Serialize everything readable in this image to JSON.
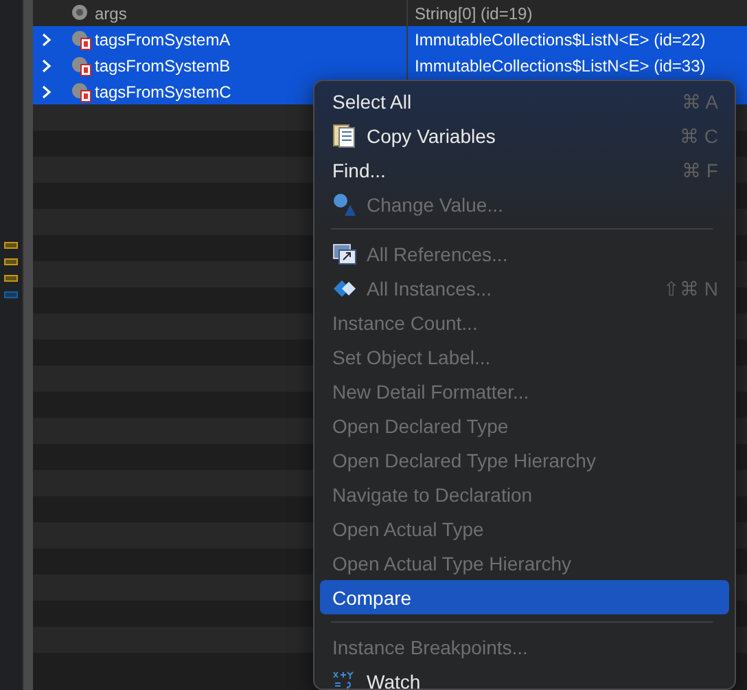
{
  "variables": {
    "rows": [
      {
        "name": "args",
        "value": "String[0]  (id=19)",
        "expandable": false,
        "selected": false
      },
      {
        "name": "tagsFromSystemA",
        "value": "ImmutableCollections$ListN<E>  (id=22)",
        "expandable": true,
        "selected": true
      },
      {
        "name": "tagsFromSystemB",
        "value": "ImmutableCollections$ListN<E>  (id=33)",
        "expandable": true,
        "selected": true
      },
      {
        "name": "tagsFromSystemC",
        "expandable": true,
        "selected": true
      }
    ]
  },
  "gutter_markers": [
    {
      "color": "#c49a0e"
    },
    {
      "color": "#c49a0e"
    },
    {
      "color": "#c49a0e"
    },
    {
      "color": "#1160a8"
    }
  ],
  "context_menu": {
    "items": [
      {
        "kind": "item",
        "label": "Select All",
        "shortcut": "⌘ A",
        "disabled": false,
        "selected": false
      },
      {
        "kind": "item",
        "label": "Copy Variables",
        "shortcut": "⌘ C",
        "disabled": false,
        "selected": false
      },
      {
        "kind": "item",
        "label": "Find...",
        "shortcut": "⌘ F",
        "disabled": false,
        "selected": false
      },
      {
        "kind": "item",
        "label": "Change Value...",
        "disabled": true,
        "selected": false
      },
      {
        "kind": "separator"
      },
      {
        "kind": "item",
        "label": "All References...",
        "disabled": true,
        "selected": false
      },
      {
        "kind": "item",
        "label": "All Instances...",
        "shortcut": "⇧⌘ N",
        "disabled": true,
        "selected": false
      },
      {
        "kind": "item",
        "label": "Instance Count...",
        "disabled": true,
        "selected": false
      },
      {
        "kind": "item",
        "label": "Set Object Label...",
        "disabled": true,
        "selected": false
      },
      {
        "kind": "item",
        "label": "New Detail Formatter...",
        "disabled": true,
        "selected": false
      },
      {
        "kind": "item",
        "label": "Open Declared Type",
        "disabled": true,
        "selected": false
      },
      {
        "kind": "item",
        "label": "Open Declared Type Hierarchy",
        "disabled": true,
        "selected": false
      },
      {
        "kind": "item",
        "label": "Navigate to Declaration",
        "disabled": true,
        "selected": false
      },
      {
        "kind": "item",
        "label": "Open Actual Type",
        "disabled": true,
        "selected": false
      },
      {
        "kind": "item",
        "label": "Open Actual Type Hierarchy",
        "disabled": true,
        "selected": false
      },
      {
        "kind": "item",
        "label": "Compare",
        "disabled": false,
        "selected": true
      },
      {
        "kind": "separator"
      },
      {
        "kind": "item",
        "label": "Instance Breakpoints...",
        "disabled": true,
        "selected": false
      },
      {
        "kind": "item",
        "label": "Watch",
        "disabled": false,
        "selected": false
      }
    ]
  }
}
